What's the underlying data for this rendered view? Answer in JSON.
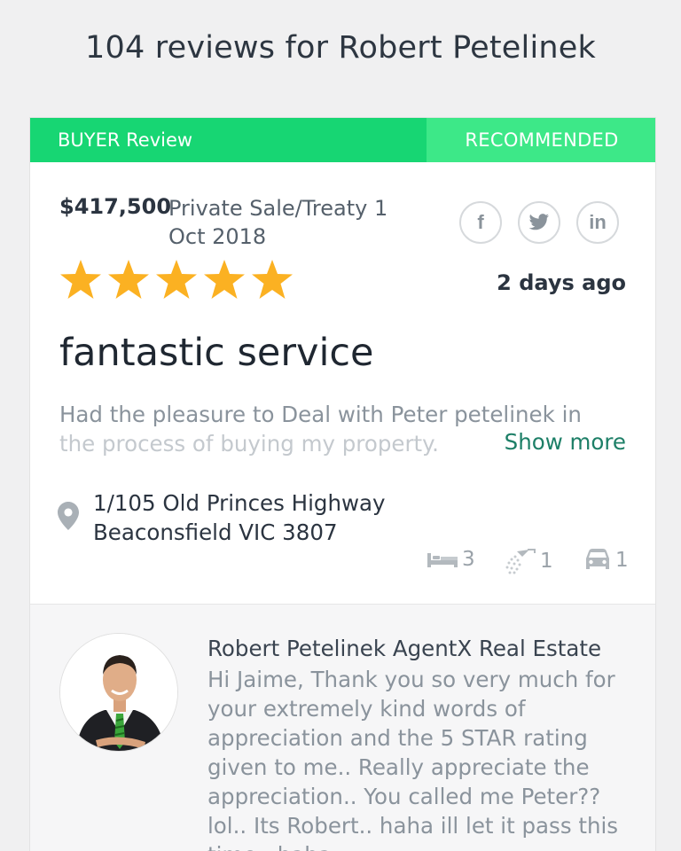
{
  "page": {
    "title": "104 reviews for Robert Petelinek"
  },
  "review": {
    "banner": {
      "reviewer_type": "BUYER Review",
      "status": "RECOMMENDED"
    },
    "price": "$417,500",
    "sale_type": "Private Sale/Treaty 1 Oct 2018",
    "rating": 5,
    "rating_max": 5,
    "posted": "2 days ago",
    "title": "fantastic service",
    "body_line1": "Had the pleasure to Deal with Peter petelinek in",
    "body_line2": "the process of buying my property.",
    "show_more": "Show more",
    "address_line1": "1/105 Old Princes Highway",
    "address_line2": "Beaconsfield VIC 3807",
    "features": {
      "beds": "3",
      "baths": "1",
      "cars": "1"
    },
    "share": {
      "facebook": "f",
      "linkedin": "in"
    }
  },
  "reply": {
    "author": "Robert Petelinek AgentX Real Estate",
    "text": "Hi Jaime, Thank you so very much for your extremely kind words of appreciation and the 5 STAR rating given to me.. Really appreciate the appreciation.. You called me Peter?? lol.. Its Robert.. haha ill let it pass this time.. haha"
  },
  "colors": {
    "accent": "#17d673",
    "accent_light": "#3de888",
    "star": "#fbb122",
    "link": "#1d7f67"
  }
}
